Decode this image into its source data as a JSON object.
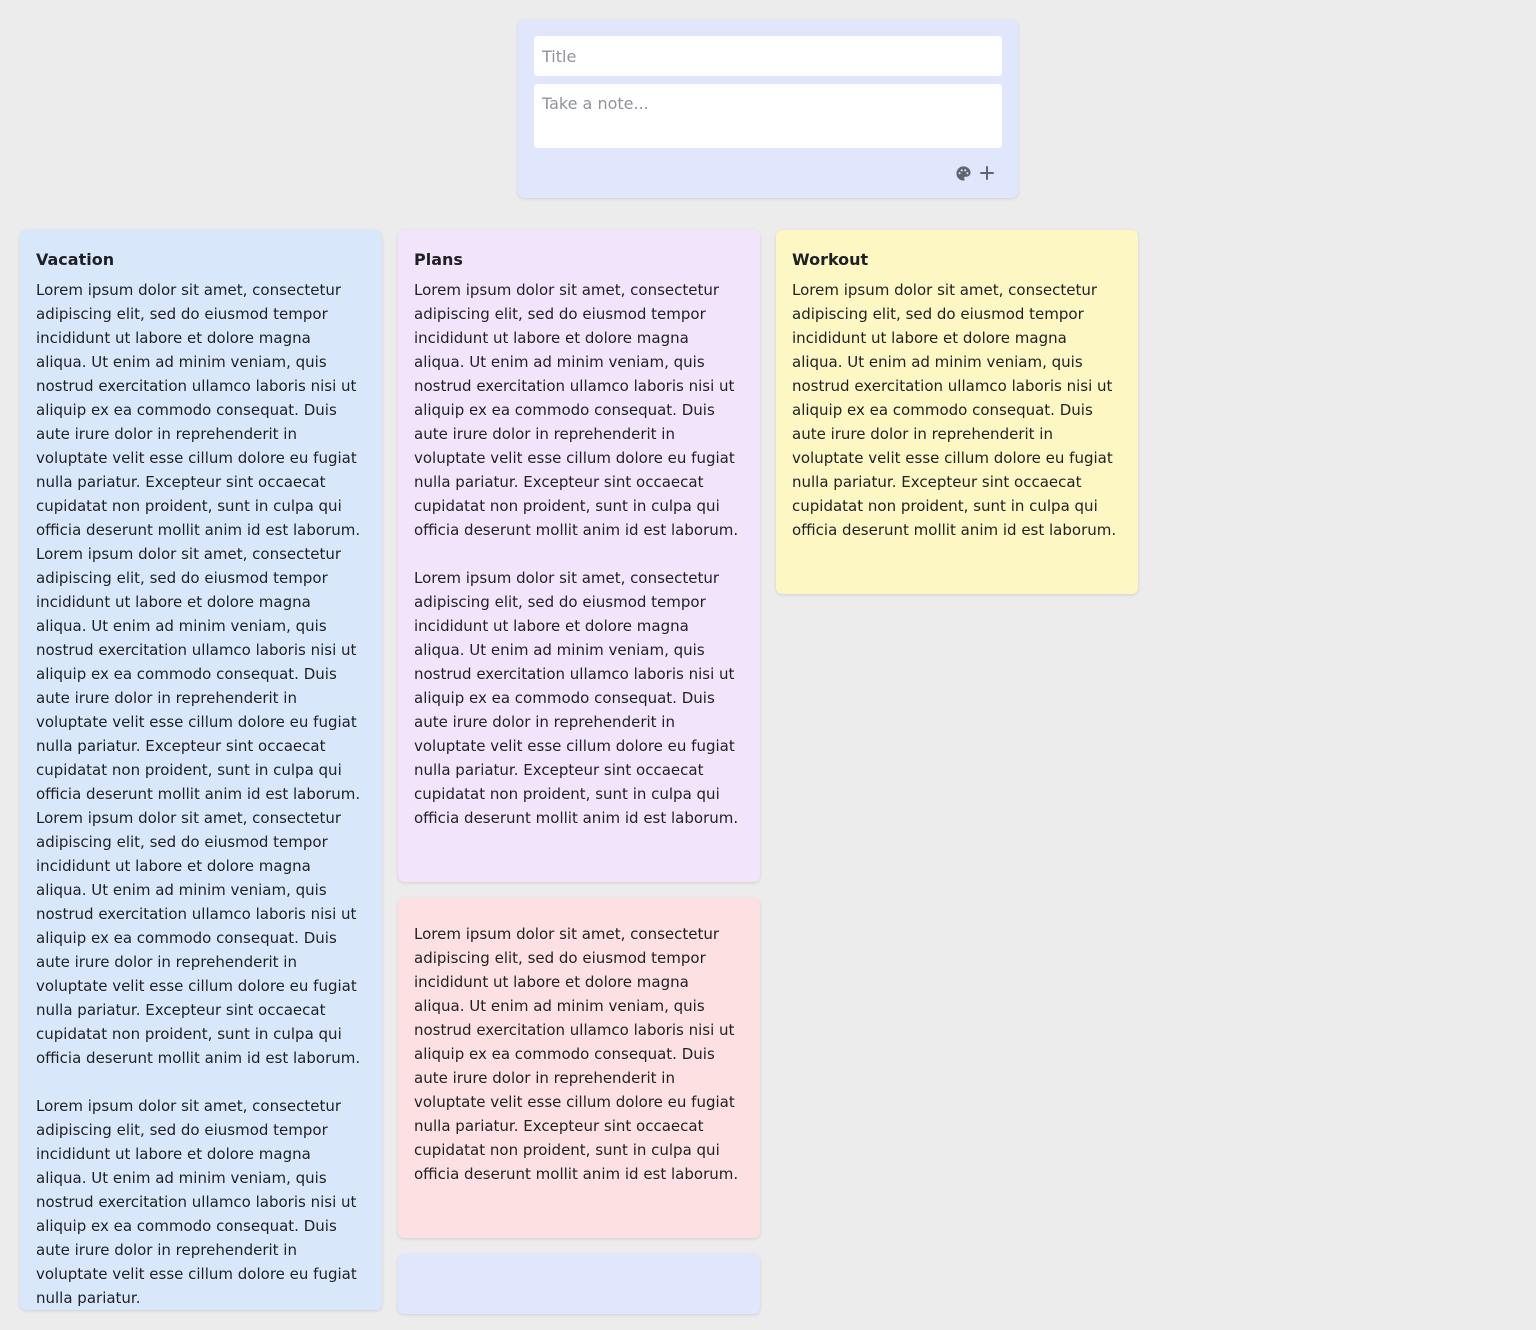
{
  "composer": {
    "title_placeholder": "Title",
    "body_placeholder": "Take a note...",
    "actions": [
      {
        "icon": "palette-icon"
      },
      {
        "icon": "plus-icon"
      }
    ]
  },
  "colors": {
    "background": "#ececec",
    "composer": "#e0e6fb",
    "blue": "#d9e7fb",
    "purple": "#f1e4fb",
    "yellow": "#fdf7c3",
    "pink": "#fde0e1",
    "indigo": "#e0e6fb"
  },
  "notes": [
    {
      "title": "Vacation",
      "color": "blue",
      "body": "Lorem ipsum dolor sit amet, consectetur adipiscing elit, sed do eiusmod tempor incididunt ut labore et dolore magna aliqua. Ut enim ad minim veniam, quis nostrud exercitation ullamco laboris nisi ut aliquip ex ea commodo consequat. Duis aute irure dolor in reprehenderit in voluptate velit esse cillum dolore eu fugiat nulla pariatur. Excepteur sint occaecat cupidatat non proident, sunt in culpa qui officia deserunt mollit anim id est laborum.\nLorem ipsum dolor sit amet, consectetur adipiscing elit, sed do eiusmod tempor incididunt ut labore et dolore magna aliqua. Ut enim ad minim veniam, quis nostrud exercitation ullamco laboris nisi ut aliquip ex ea commodo consequat. Duis aute irure dolor in reprehenderit in voluptate velit esse cillum dolore eu fugiat nulla pariatur. Excepteur sint occaecat cupidatat non proident, sunt in culpa qui officia deserunt mollit anim id est laborum.\nLorem ipsum dolor sit amet, consectetur adipiscing elit, sed do eiusmod tempor incididunt ut labore et dolore magna aliqua. Ut enim ad minim veniam, quis nostrud exercitation ullamco laboris nisi ut aliquip ex ea commodo consequat. Duis aute irure dolor in reprehenderit in voluptate velit esse cillum dolore eu fugiat nulla pariatur. Excepteur sint occaecat cupidatat non proident, sunt in culpa qui officia deserunt mollit anim id est laborum.\n\nLorem ipsum dolor sit amet, consectetur adipiscing elit, sed do eiusmod tempor incididunt ut labore et dolore magna aliqua. Ut enim ad minim veniam, quis nostrud exercitation ullamco laboris nisi ut aliquip ex ea commodo consequat. Duis aute irure dolor in reprehenderit in voluptate velit esse cillum dolore eu fugiat nulla pariatur."
    },
    {
      "title": "Plans",
      "color": "purple",
      "body": "Lorem ipsum dolor sit amet, consectetur adipiscing elit, sed do eiusmod tempor incididunt ut labore et dolore magna aliqua. Ut enim ad minim veniam, quis nostrud exercitation ullamco laboris nisi ut aliquip ex ea commodo consequat. Duis aute irure dolor in reprehenderit in voluptate velit esse cillum dolore eu fugiat nulla pariatur. Excepteur sint occaecat cupidatat non proident, sunt in culpa qui officia deserunt mollit anim id est laborum.\n\nLorem ipsum dolor sit amet, consectetur adipiscing elit, sed do eiusmod tempor incididunt ut labore et dolore magna aliqua. Ut enim ad minim veniam, quis nostrud exercitation ullamco laboris nisi ut aliquip ex ea commodo consequat. Duis aute irure dolor in reprehenderit in voluptate velit esse cillum dolore eu fugiat nulla pariatur. Excepteur sint occaecat cupidatat non proident, sunt in culpa qui officia deserunt mollit anim id est laborum."
    },
    {
      "title": "",
      "color": "pink",
      "body": "Lorem ipsum dolor sit amet, consectetur adipiscing elit, sed do eiusmod tempor incididunt ut labore et dolore magna aliqua. Ut enim ad minim veniam, quis nostrud exercitation ullamco laboris nisi ut aliquip ex ea commodo consequat. Duis aute irure dolor in reprehenderit in voluptate velit esse cillum dolore eu fugiat nulla pariatur. Excepteur sint occaecat cupidatat non proident, sunt in culpa qui officia deserunt mollit anim id est laborum."
    },
    {
      "title": "",
      "color": "indigo",
      "body": ""
    },
    {
      "title": "Workout",
      "color": "yellow",
      "body": "Lorem ipsum dolor sit amet, consectetur adipiscing elit, sed do eiusmod tempor incididunt ut labore et dolore magna aliqua. Ut enim ad minim veniam, quis nostrud exercitation ullamco laboris nisi ut aliquip ex ea commodo consequat. Duis aute irure dolor in reprehenderit in voluptate velit esse cillum dolore eu fugiat nulla pariatur. Excepteur sint occaecat cupidatat non proident, sunt in culpa qui officia deserunt mollit anim id est laborum."
    }
  ]
}
